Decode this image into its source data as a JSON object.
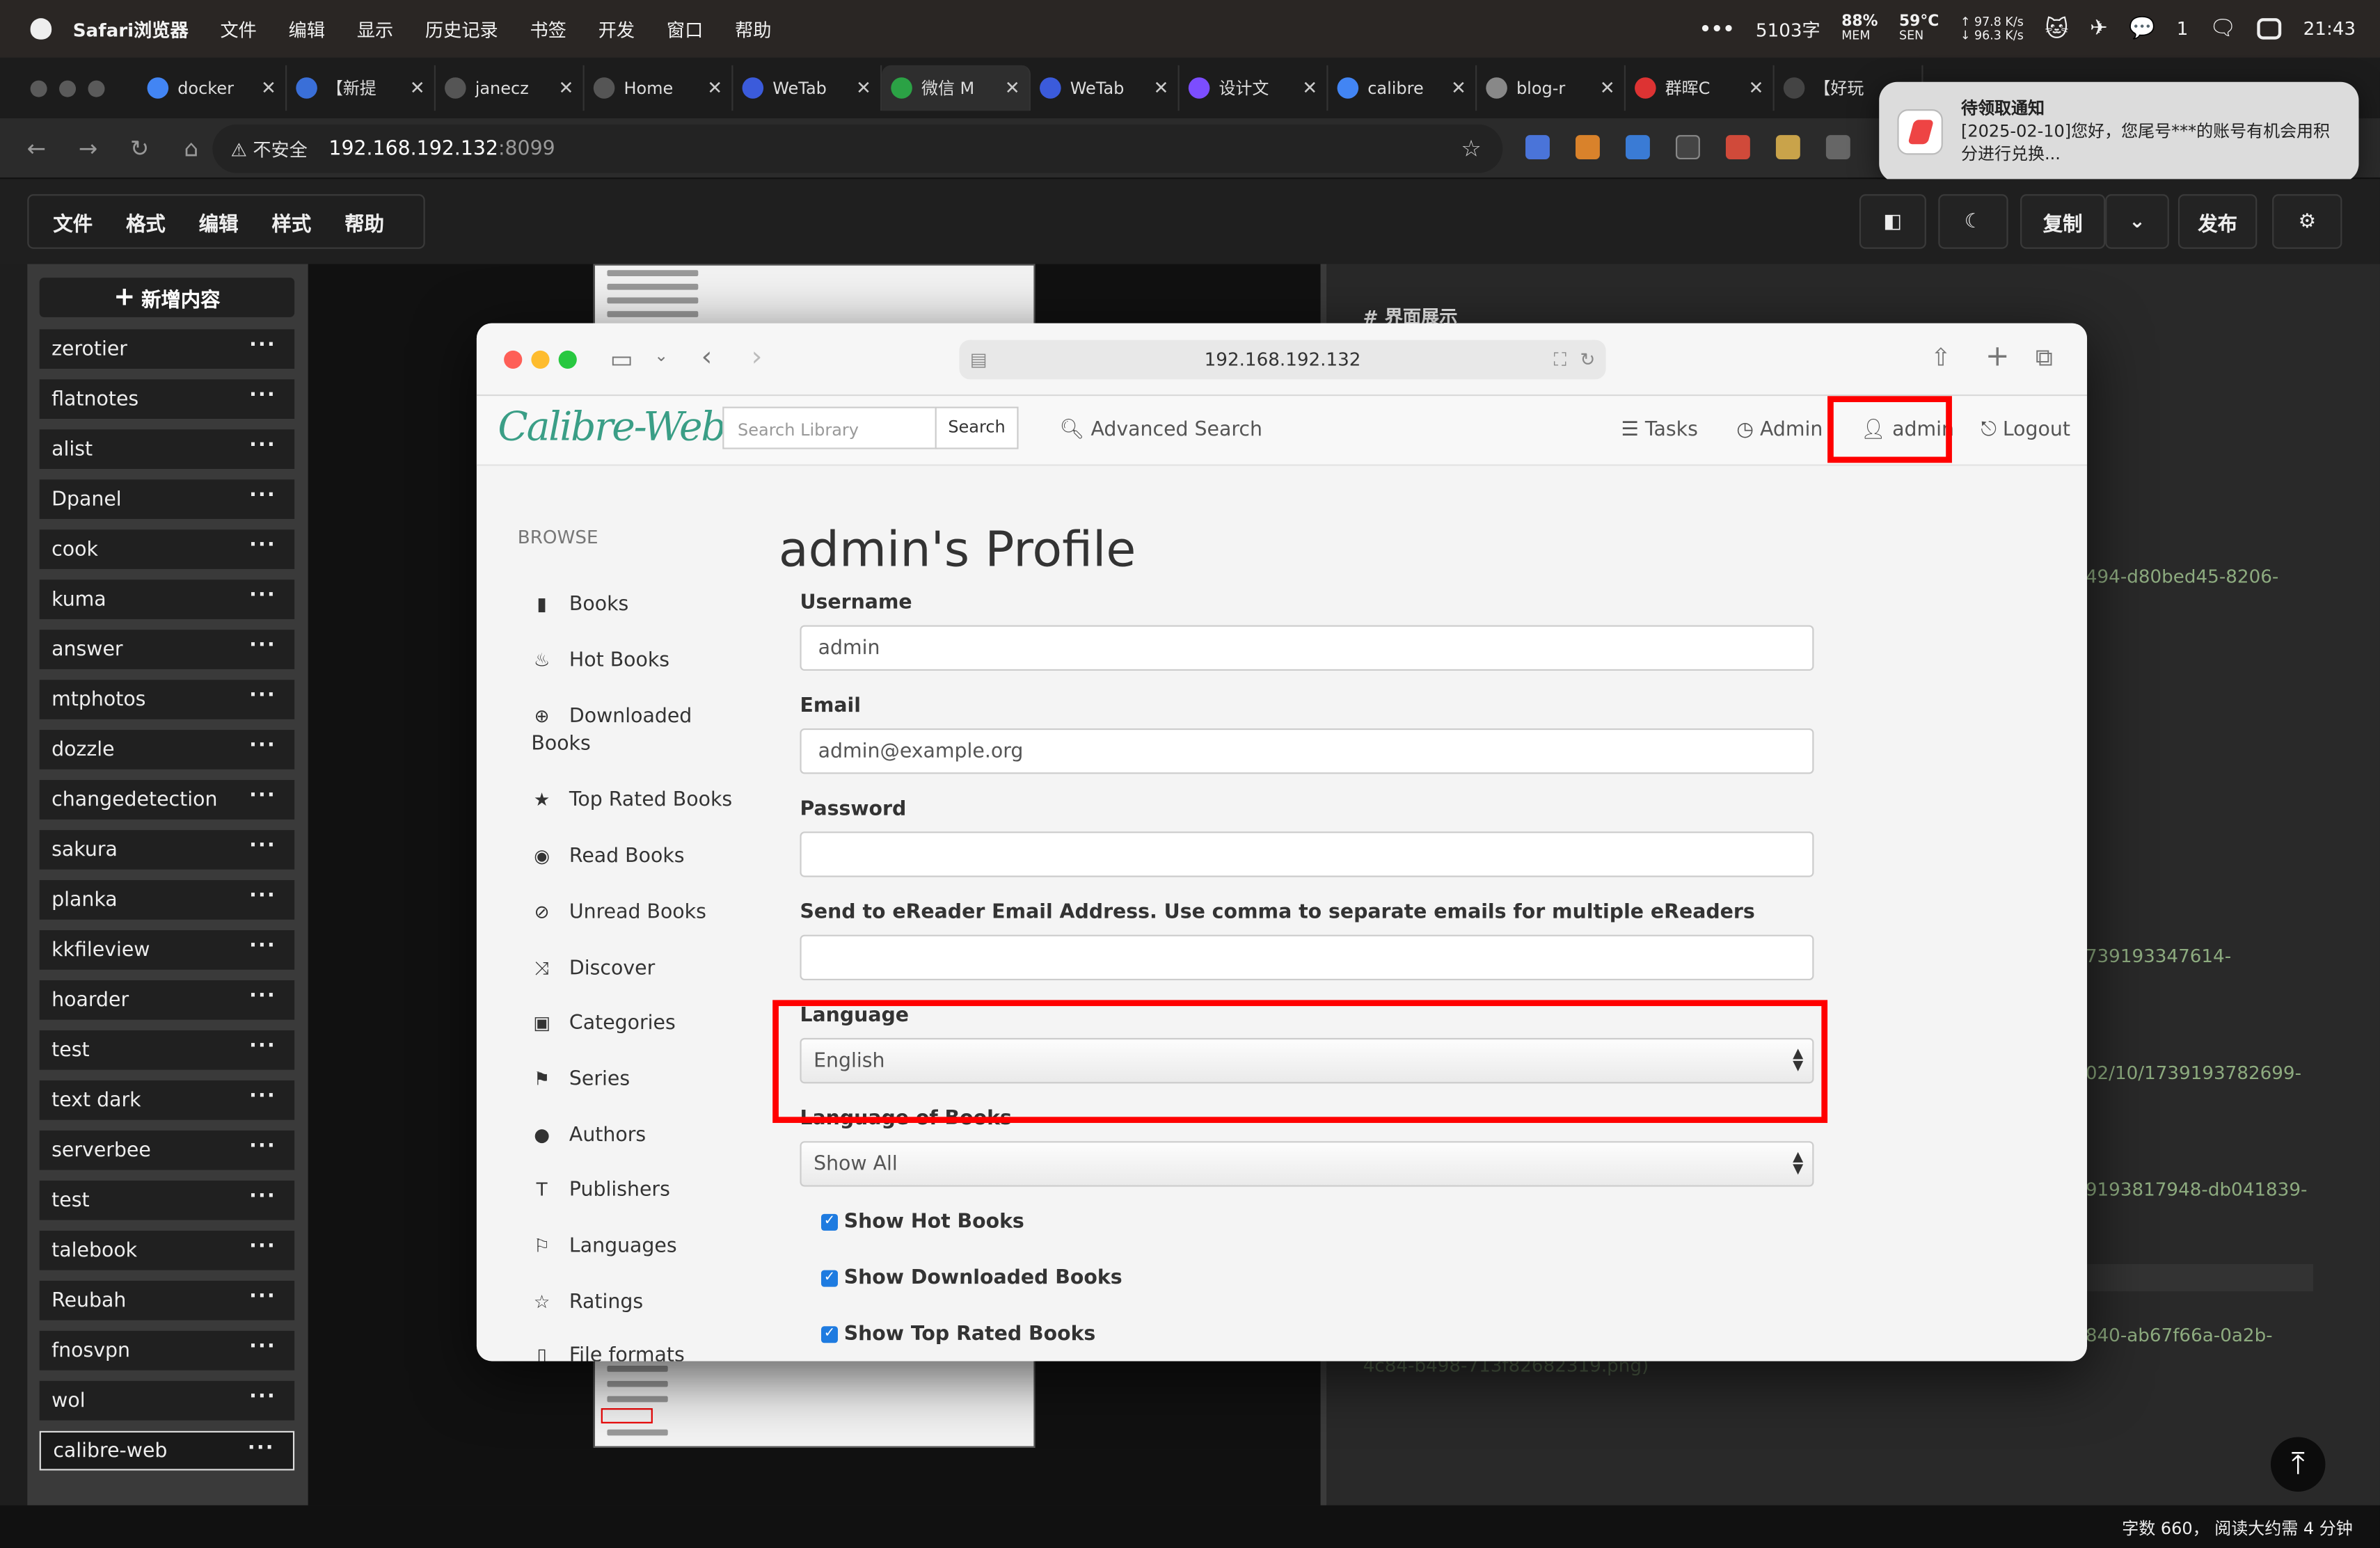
{
  "menubar": {
    "app": "Safari浏览器",
    "items": [
      "文件",
      "编辑",
      "显示",
      "历史记录",
      "书签",
      "开发",
      "窗口",
      "帮助"
    ],
    "word_count": "5103字",
    "mem": "88%",
    "mem_label": "MEM",
    "temp": "59°C",
    "temp_label": "SEN",
    "net_up": "↑ 97.8 K/s",
    "net_down": "↓ 96.3 K/s",
    "wechat_badge": "1",
    "time": "21:43"
  },
  "tabs": [
    {
      "title": "docker",
      "color": "#4285f4"
    },
    {
      "title": "【新提",
      "color": "#3a6fd8"
    },
    {
      "title": "janecz",
      "color": "#555"
    },
    {
      "title": "Home",
      "color": "#555"
    },
    {
      "title": "WeTab",
      "color": "#3b5bdb"
    },
    {
      "title": "微信 M",
      "color": "#2ba245"
    },
    {
      "title": "WeTab",
      "color": "#3b5bdb"
    },
    {
      "title": "设计文",
      "color": "#7c4dff"
    },
    {
      "title": "calibre",
      "color": "#4285f4"
    },
    {
      "title": "blog-r",
      "color": "#888"
    },
    {
      "title": "群晖C",
      "color": "#d33"
    },
    {
      "title": "【好玩",
      "color": "#444"
    }
  ],
  "address": {
    "insecure": "不安全",
    "host": "192.168.192.132",
    "port": ":8099"
  },
  "notification": {
    "title": "待领取通知",
    "body": "[2025-02-10]您好，您尾号***的账号有机会用积分进行兑换..."
  },
  "editor": {
    "menu": [
      "文件",
      "格式",
      "编辑",
      "样式",
      "帮助"
    ],
    "copy_label": "复制",
    "publish_label": "发布"
  },
  "sidebar": {
    "new_label": "新增内容",
    "items": [
      "zerotier",
      "flatnotes",
      "alist",
      "Dpanel",
      "cook",
      "kuma",
      "answer",
      "mtphotos",
      "dozzle",
      "changedetection",
      "sakura",
      "planka",
      "kkfileview",
      "hoarder",
      "test",
      "text dark",
      "serverbee",
      "test",
      "talebook",
      "Reubah",
      "fnosvpn",
      "wol",
      "calibre-web"
    ],
    "active": "calibre-web"
  },
  "preview": {
    "heading": "# 界面展示",
    "frag1": "494-d80bed45-8206-",
    "frag2": "739193347614-",
    "frag3": "02/10/1739193782699-",
    "frag4": "9193817948-db041839-",
    "frag5": "840-ab67f66a-0a2b-",
    "frag6": "4c84-b498-713f82682319.png)"
  },
  "status": {
    "text": "字数 660，   阅读大约需 4 分钟"
  },
  "inner": {
    "url": "192.168.192.132",
    "logo": "Calibre-Web",
    "search_placeholder": "Search Library",
    "search_button": "Search",
    "advanced": "Advanced Search",
    "tasks": "Tasks",
    "admin_link": "Admin",
    "user_link": "admin",
    "logout": "Logout",
    "browse_title": "BROWSE",
    "browse": [
      {
        "label": "Books",
        "icon": "book-icon"
      },
      {
        "label": "Hot Books",
        "icon": "fire-icon"
      },
      {
        "label": "Downloaded Books",
        "icon": "download-icon"
      },
      {
        "label": "Top Rated Books",
        "icon": "star-icon"
      },
      {
        "label": "Read Books",
        "icon": "eye-icon"
      },
      {
        "label": "Unread Books",
        "icon": "eye-slash-icon"
      },
      {
        "label": "Discover",
        "icon": "random-icon"
      },
      {
        "label": "Categories",
        "icon": "inbox-icon"
      },
      {
        "label": "Series",
        "icon": "bookmark-icon"
      },
      {
        "label": "Authors",
        "icon": "user-icon"
      },
      {
        "label": "Publishers",
        "icon": "text-size-icon"
      },
      {
        "label": "Languages",
        "icon": "flag-icon"
      },
      {
        "label": "Ratings",
        "icon": "star-empty-icon"
      },
      {
        "label": "File formats",
        "icon": "file-icon"
      }
    ],
    "profile_title": "admin's Profile",
    "username_label": "Username",
    "username_value": "admin",
    "email_label": "Email",
    "email_value": "admin@example.org",
    "password_label": "Password",
    "password_value": "",
    "kindle_label": "Send to eReader Email Address. Use comma to separate emails for multiple eReaders",
    "kindle_value": "",
    "language_label": "Language",
    "language_value": "English",
    "book_lang_label": "Language of Books",
    "book_lang_value": "Show All",
    "checks": [
      "Show Hot Books",
      "Show Downloaded Books",
      "Show Top Rated Books"
    ]
  }
}
